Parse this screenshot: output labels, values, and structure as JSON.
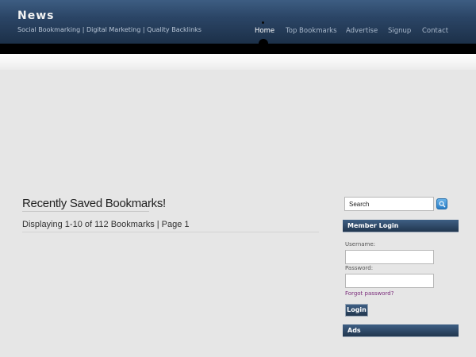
{
  "site": {
    "title": "News",
    "tagline": "Social Bookmarking | Digital Marketing | Quality Backlinks"
  },
  "nav": {
    "items": [
      {
        "label": "Home",
        "active": true
      },
      {
        "label": "Top Bookmarks",
        "active": false
      },
      {
        "label": "Advertise",
        "active": false
      },
      {
        "label": "Signup",
        "active": false
      },
      {
        "label": "Contact",
        "active": false
      }
    ]
  },
  "main": {
    "title": "Recently Saved Bookmarks!",
    "display_info": "Displaying 1-10 of 112 Bookmarks | Page 1"
  },
  "sidebar": {
    "search": {
      "placeholder": "Search",
      "icon": "search-icon"
    },
    "login_widget": {
      "title": "Member Login",
      "username_label": "Username:",
      "password_label": "Password:",
      "forgot_link": "Forgot password?",
      "login_button": "Login"
    },
    "ads_widget": {
      "title": "Ads"
    }
  },
  "colors": {
    "header_top": "#3d5d82",
    "header_bottom": "#1c3048",
    "body_bg": "#e6e6e6",
    "forgot_link": "#7a2b7a"
  }
}
